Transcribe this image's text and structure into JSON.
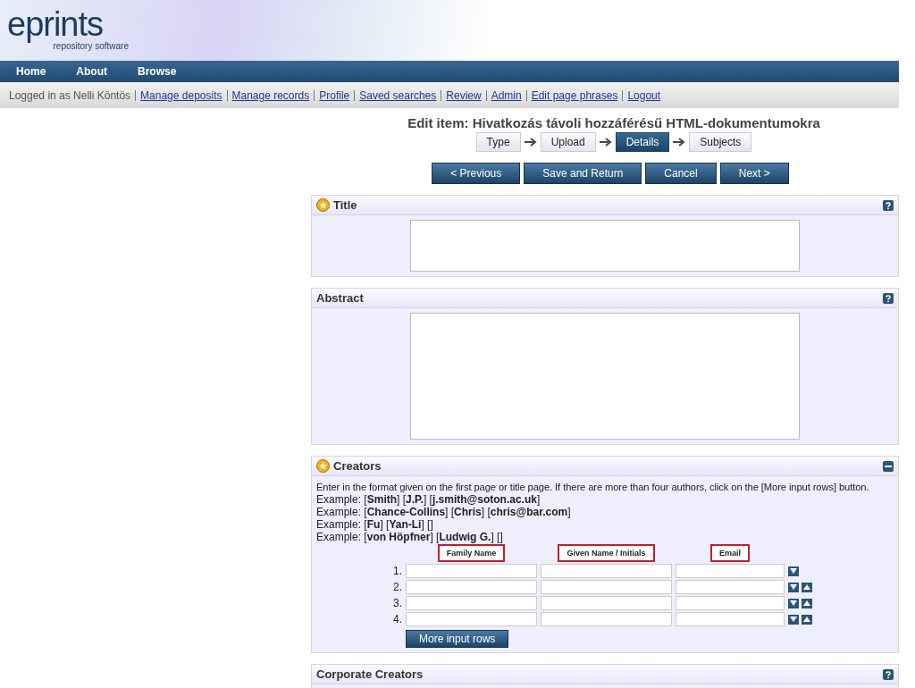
{
  "logo": {
    "name": "eprints",
    "tagline": "repository software"
  },
  "nav": [
    "Home",
    "About",
    "Browse"
  ],
  "userbar": {
    "logged_in": "Logged in as Nelli Köntös",
    "links": [
      "Manage deposits",
      "Manage records",
      "Profile",
      "Saved searches",
      "Review",
      "Admin",
      "Edit page phrases",
      "Logout"
    ]
  },
  "page_title": "Edit item: Hivatkozás távoli hozzáférésű HTML-dokumentumokra",
  "steps": [
    {
      "label": "Type",
      "selected": false
    },
    {
      "label": "Upload",
      "selected": false
    },
    {
      "label": "Details",
      "selected": true
    },
    {
      "label": "Subjects",
      "selected": false
    }
  ],
  "buttons": [
    "< Previous",
    "Save and Return",
    "Cancel",
    "Next >"
  ],
  "sections": [
    {
      "kind": "shorttext",
      "title": "Title",
      "required": true,
      "collapsible": false
    },
    {
      "kind": "longtext",
      "title": "Abstract",
      "required": false,
      "collapsible": false
    },
    {
      "kind": "names",
      "title": "Creators",
      "required": true,
      "collapsible": true,
      "help": "Enter in the format given on the first page or title page. If there are more than four authors, click on the [More input rows] button.",
      "examples": [
        "Example: [**Smith**] [**J.P.**] [**j.smith@soton.ac.uk**]",
        "Example: [**Chance-Collins**] [**Chris**] [**chris@bar.com**]",
        "Example: [**Fu**] [**Yan-Li**] []",
        "Example: [**von Höpfner**] [**Ludwig G.**] []"
      ],
      "columns": [
        "Family Name",
        "Given Name / Initials",
        "Email"
      ],
      "rows": [
        {
          "index": "1.",
          "down": true,
          "up": false
        },
        {
          "index": "2.",
          "down": true,
          "up": true
        },
        {
          "index": "3.",
          "down": true,
          "up": true
        },
        {
          "index": "4.",
          "down": true,
          "up": true
        }
      ],
      "more_button": "More input rows"
    },
    {
      "kind": "single",
      "title": "Corporate Creators",
      "required": false,
      "collapsible": false
    }
  ]
}
